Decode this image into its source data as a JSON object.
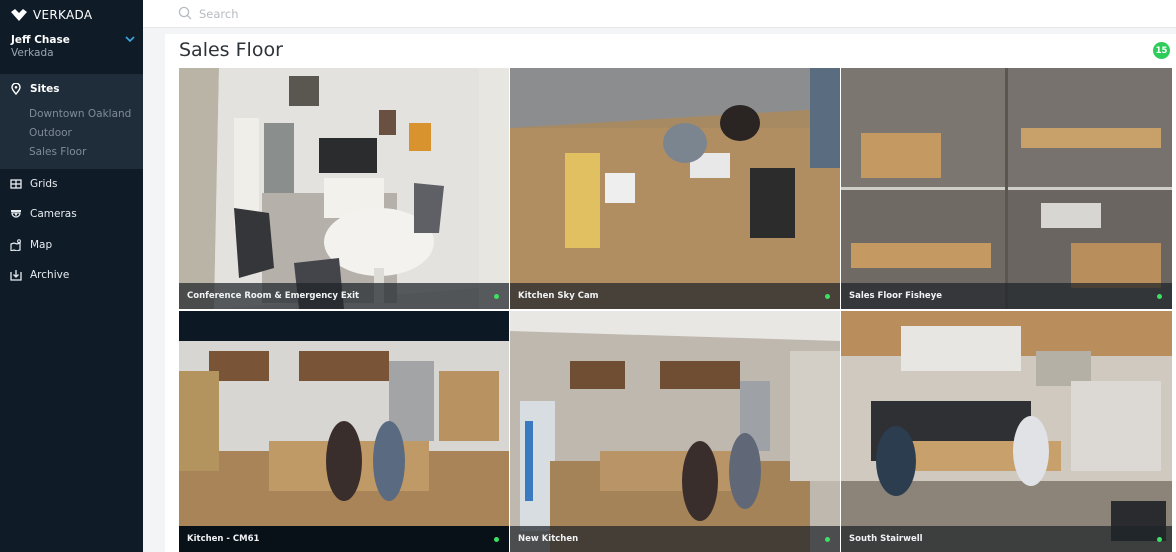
{
  "brand": {
    "name": "VERKADA",
    "icon": "verkada-logo-icon"
  },
  "user": {
    "name": "Jeff Chase",
    "org": "Verkada"
  },
  "sidebar": {
    "sites": {
      "label": "Sites",
      "icon": "map-pin-icon",
      "items": [
        {
          "label": "Downtown Oakland"
        },
        {
          "label": "Outdoor"
        },
        {
          "label": "Sales Floor"
        }
      ]
    },
    "items": [
      {
        "label": "Grids",
        "icon": "grid-icon"
      },
      {
        "label": "Cameras",
        "icon": "camera-icon"
      },
      {
        "label": "Map",
        "icon": "map-icon"
      },
      {
        "label": "Archive",
        "icon": "archive-icon"
      }
    ]
  },
  "search": {
    "placeholder": "Search",
    "value": ""
  },
  "page": {
    "title": "Sales Floor",
    "camera_count": "15"
  },
  "colors": {
    "sidebar_bg": "#0f1b27",
    "sites_bg": "#1f2c39",
    "online": "#3ee063",
    "badge": "#2ecc5a"
  },
  "cameras": [
    {
      "name": "Conference Room & Emergency Exit",
      "status": "online"
    },
    {
      "name": "Kitchen Sky Cam",
      "status": "online"
    },
    {
      "name": "Sales Floor Fisheye",
      "status": "online"
    },
    {
      "name": "Kitchen - CM61",
      "status": "online"
    },
    {
      "name": "New Kitchen",
      "status": "online"
    },
    {
      "name": "South Stairwell",
      "status": "online"
    }
  ]
}
